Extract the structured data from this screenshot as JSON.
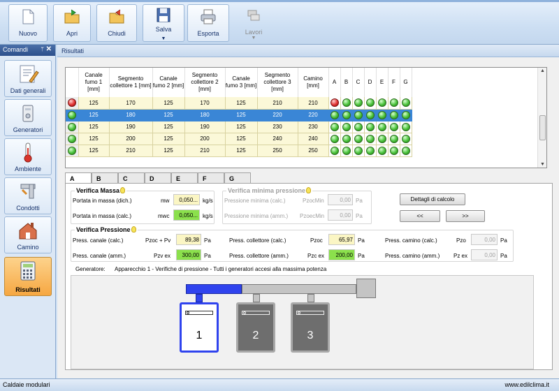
{
  "toolbar": {
    "buttons": [
      {
        "label": "Nuovo",
        "icon": "new-document-icon"
      },
      {
        "label": "Apri",
        "icon": "open-folder-icon"
      },
      {
        "label": "Chiudi",
        "icon": "close-folder-icon"
      },
      {
        "label": "Salva",
        "icon": "floppy-disk-icon",
        "dropdown": "▼"
      },
      {
        "label": "Esporta",
        "icon": "printer-icon"
      },
      {
        "label": "Lavori",
        "icon": "jobs-icon",
        "dropdown": "▼",
        "disabled": true
      }
    ]
  },
  "sidebar": {
    "title": "Comandi",
    "pin": "ᛘ",
    "close": "✕",
    "items": [
      {
        "label": "Dati generali",
        "icon": "general-data-icon"
      },
      {
        "label": "Generatori",
        "icon": "generators-icon"
      },
      {
        "label": "Ambiente",
        "icon": "thermometer-icon"
      },
      {
        "label": "Condotti",
        "icon": "ducts-icon"
      },
      {
        "label": "Camino",
        "icon": "chimney-icon"
      },
      {
        "label": "Risultati",
        "icon": "calculator-icon",
        "active": true
      }
    ]
  },
  "main": {
    "title": "Risultati",
    "grid": {
      "headers": [
        "Canale fumo 1 [mm]",
        "Segmento collettore 1 [mm]",
        "Canale fumo 2 [mm]",
        "Segmento collettore 2 [mm]",
        "Canale fumo 3 [mm]",
        "Segmento collettore 3 [mm]",
        "Camino [mm]"
      ],
      "letters": [
        "A",
        "B",
        "C",
        "D",
        "E",
        "F",
        "G"
      ],
      "rows": [
        {
          "status": "red",
          "values": [
            "125",
            "170",
            "125",
            "170",
            "125",
            "210",
            "210"
          ],
          "leds": [
            "red",
            "green",
            "green",
            "green",
            "green",
            "green",
            "green"
          ]
        },
        {
          "status": "green",
          "selected": true,
          "values": [
            "125",
            "180",
            "125",
            "180",
            "125",
            "220",
            "220"
          ],
          "leds": [
            "green",
            "green",
            "green",
            "green",
            "green",
            "green",
            "green"
          ]
        },
        {
          "status": "green",
          "values": [
            "125",
            "190",
            "125",
            "190",
            "125",
            "230",
            "230"
          ],
          "leds": [
            "green",
            "green",
            "green",
            "green",
            "green",
            "green",
            "green"
          ]
        },
        {
          "status": "green",
          "values": [
            "125",
            "200",
            "125",
            "200",
            "125",
            "240",
            "240"
          ],
          "leds": [
            "green",
            "green",
            "green",
            "green",
            "green",
            "green",
            "green"
          ]
        },
        {
          "status": "green",
          "values": [
            "125",
            "210",
            "125",
            "210",
            "125",
            "250",
            "250"
          ],
          "leds": [
            "green",
            "green",
            "green",
            "green",
            "green",
            "green",
            "green"
          ]
        }
      ]
    },
    "tabs": [
      "A",
      "B",
      "C",
      "D",
      "E",
      "F",
      "G"
    ],
    "active_tab": "A",
    "massa": {
      "title": "Verifica Massa",
      "rows": [
        {
          "label": "Portata in massa (dich.)",
          "sym": "mw",
          "value": "0,050...",
          "unit": "kg/s"
        },
        {
          "label": "Portata in massa (calc.)",
          "sym": "mwc",
          "value": "0,050...",
          "unit": "kg/s"
        }
      ]
    },
    "minima": {
      "title": "Verifica minima pressione",
      "rows": [
        {
          "label": "Pressione minima (calc.)",
          "sym": "PzocMin",
          "value": "0,00",
          "unit": "Pa"
        },
        {
          "label": "Pressione minima (amm.)",
          "sym": "PzoecMin",
          "value": "0,00",
          "unit": "Pa"
        }
      ]
    },
    "buttons": {
      "dettagli": "Dettagli di calcolo",
      "prev": "<<",
      "next": ">>"
    },
    "pressione": {
      "title": "Verifica Pressione",
      "col1": [
        {
          "label": "Press. canale (calc.)",
          "sym": "Pzoc + Pv",
          "value": "89,38",
          "unit": "Pa"
        },
        {
          "label": "Press. canale (amm.)",
          "sym": "Pzv ex",
          "value": "300,00",
          "unit": "Pa"
        }
      ],
      "col2": [
        {
          "label": "Press. collettore (calc.)",
          "sym": "Pzoc",
          "value": "65,97",
          "unit": "Pa"
        },
        {
          "label": "Press. collettore (amm.)",
          "sym": "Pzc ex",
          "value": "200,00",
          "unit": "Pa"
        }
      ],
      "col3": [
        {
          "label": "Press. camino (calc.)",
          "sym": "Pzo",
          "value": "0,00",
          "unit": "Pa"
        },
        {
          "label": "Press. camino (amm.)",
          "sym": "Pz ex",
          "value": "0,00",
          "unit": "Pa"
        }
      ]
    },
    "generatore": {
      "label": "Generatore:",
      "text": "Apparecchio 1 - Verifiche di pressione - Tutti i generatori accesi alla massima potenza"
    },
    "diagram": {
      "generators": [
        "1",
        "2",
        "3"
      ],
      "active": "1"
    }
  },
  "status": {
    "left": "Caldaie modulari",
    "right": "www.edilclima.it"
  }
}
